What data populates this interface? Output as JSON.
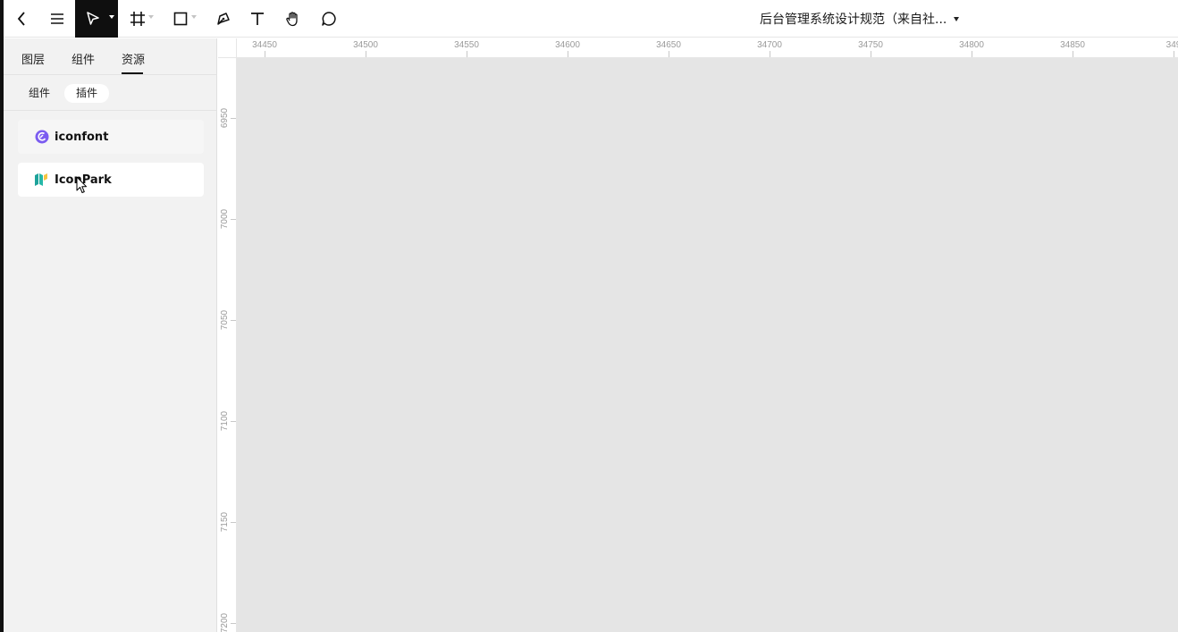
{
  "toolbar": {
    "back_icon": "chevron-left-icon",
    "menu_icon": "hamburger-menu-icon",
    "tools": [
      {
        "name": "move-tool",
        "icon": "pointer-arrow-icon",
        "active": true
      },
      {
        "name": "frame-tool",
        "icon": "frame-icon"
      },
      {
        "name": "shape-tool",
        "icon": "rectangle-icon"
      },
      {
        "name": "pen-tool",
        "icon": "pen-icon"
      },
      {
        "name": "text-tool",
        "icon": "text-icon"
      },
      {
        "name": "hand-tool",
        "icon": "hand-icon"
      },
      {
        "name": "comment-tool",
        "icon": "comment-icon"
      }
    ],
    "document_title": "后台管理系统设计规范（来自社..."
  },
  "sidebar": {
    "tabs": [
      {
        "label": "图层"
      },
      {
        "label": "组件"
      },
      {
        "label": "资源",
        "active": true
      }
    ],
    "subtabs": [
      {
        "label": "组件"
      },
      {
        "label": "插件",
        "active": true
      }
    ],
    "plugins": [
      {
        "label": "iconfont",
        "icon": "iconfont-logo-icon",
        "color": "#7b5cf0"
      },
      {
        "label": "IconPark",
        "icon": "iconpark-logo-icon",
        "color": "#1ea39b",
        "hovered": true
      }
    ]
  },
  "ruler": {
    "horizontal": [
      "34450",
      "34500",
      "34550",
      "34600",
      "34650",
      "34700",
      "34750",
      "34800",
      "34850",
      "349"
    ],
    "vertical": [
      "6950",
      "7000",
      "7050",
      "7100",
      "7150",
      "7200"
    ]
  },
  "colors": {
    "canvas": "#e5e5e5",
    "sidebar": "#f2f2f2",
    "active_tool": "#0f0f0f"
  }
}
